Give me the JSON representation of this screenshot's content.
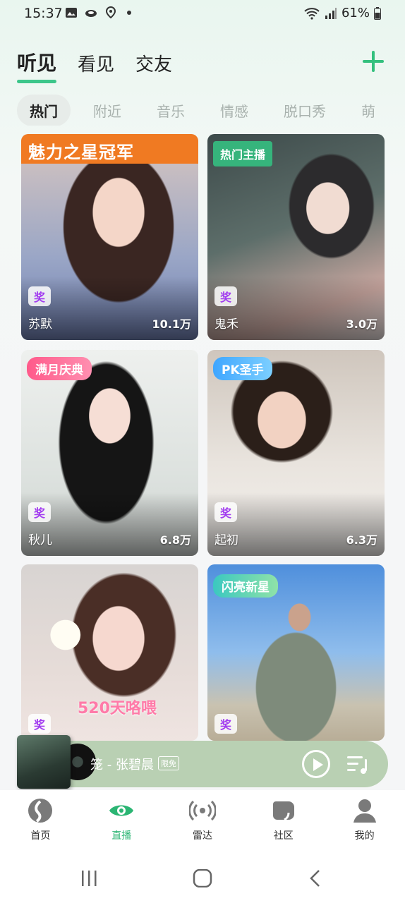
{
  "status_bar": {
    "time": "15:37",
    "battery": "61%",
    "icons": [
      "image-icon",
      "cloud-icon",
      "location-icon",
      "wifi-icon",
      "signal-icon",
      "battery-icon"
    ]
  },
  "top_tabs": [
    {
      "label": "听见",
      "active": true
    },
    {
      "label": "看见",
      "active": false
    },
    {
      "label": "交友",
      "active": false
    }
  ],
  "categories": [
    {
      "label": "热门",
      "active": true
    },
    {
      "label": "附近",
      "active": false
    },
    {
      "label": "音乐",
      "active": false
    },
    {
      "label": "情感",
      "active": false
    },
    {
      "label": "脱口秀",
      "active": false
    },
    {
      "label": "萌",
      "active": false
    }
  ],
  "cards": [
    {
      "badge": "魅力之星冠军",
      "name": "苏默",
      "count": "10.1万"
    },
    {
      "badge": "热门主播",
      "name": "鬼禾",
      "count": "3.0万"
    },
    {
      "badge": "满月庆典",
      "name": "秋儿",
      "count": "6.8万"
    },
    {
      "badge": "PK圣手",
      "name": "起初",
      "count": "6.3万"
    },
    {
      "badge": "",
      "name": "",
      "count": "",
      "overlay_text": "520天咯喂"
    },
    {
      "badge": "闪亮新星",
      "name": "",
      "count": ""
    }
  ],
  "live_icon_label": "奖",
  "player": {
    "title": "笼 - 张碧晨",
    "tag": "限免"
  },
  "bottom_nav": [
    {
      "label": "首页",
      "active": false
    },
    {
      "label": "直播",
      "active": true
    },
    {
      "label": "雷达",
      "active": false
    },
    {
      "label": "社区",
      "active": false
    },
    {
      "label": "我的",
      "active": false
    }
  ],
  "colors": {
    "accent": "#3cc68a",
    "player_bg": "#b9d0b3"
  }
}
